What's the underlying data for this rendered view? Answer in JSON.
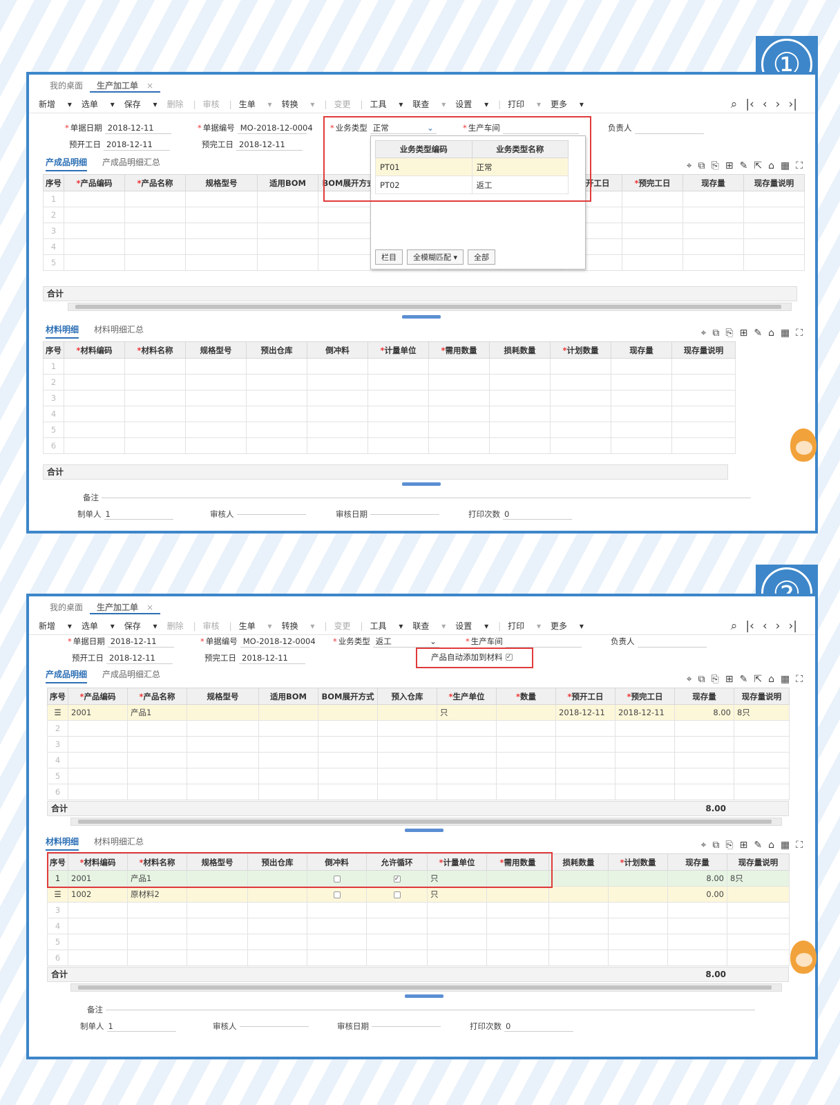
{
  "badges": {
    "one": "①",
    "two": "②"
  },
  "tabs": {
    "desk": "我的桌面",
    "order": "生产加工单",
    "close": "×"
  },
  "toolbar": {
    "new": "新增",
    "select": "选单",
    "save": "保存",
    "delete": "删除",
    "audit": "审核",
    "gen": "生单",
    "convert": "转换",
    "change": "变更",
    "tools": "工具",
    "query": "联查",
    "settings": "设置",
    "print": "打印",
    "more": "更多"
  },
  "form": {
    "date_label": "单据日期",
    "date_value": "2018-12-11",
    "code_label": "单据编号",
    "code_value": "MO-2018-12-0004",
    "btype_label": "业务类型",
    "btype_value1": "正常",
    "btype_value2": "返工",
    "workshop_label": "生产车间",
    "owner_label": "负责人",
    "start_label": "预开工日",
    "start_value": "2018-12-11",
    "finish_label": "预完工日",
    "finish_value": "2018-12-11",
    "auto_add_label": "产品自动添加到材料"
  },
  "subtabs": {
    "prod": "产成品明细",
    "prod_sum": "产成品明细汇总",
    "mat": "材料明细",
    "mat_sum": "材料明细汇总"
  },
  "prod_headers": [
    "序号",
    "产品编码",
    "产品名称",
    "规格型号",
    "适用BOM",
    "BOM展开方式",
    "预入仓库",
    "生产单位",
    "数量",
    "预开工日",
    "预完工日",
    "现存量",
    "现存量说明"
  ],
  "mat_headers1": [
    "序号",
    "材料编码",
    "材料名称",
    "规格型号",
    "预出仓库",
    "倒冲料",
    "计量单位",
    "需用数量",
    "损耗数量",
    "计划数量",
    "现存量",
    "现存量说明"
  ],
  "mat_headers2": [
    "序号",
    "材料编码",
    "材料名称",
    "规格型号",
    "预出仓库",
    "倒冲料",
    "允许循环",
    "计量单位",
    "需用数量",
    "损耗数量",
    "计划数量",
    "现存量",
    "现存量说明"
  ],
  "rownums": [
    "1",
    "2",
    "3",
    "4",
    "5",
    "6"
  ],
  "sum_label": "合计",
  "dropdown": {
    "h_code": "业务类型编码",
    "h_name": "业务类型名称",
    "r1_code": "PT01",
    "r1_name": "正常",
    "r2_code": "PT02",
    "r2_name": "返工",
    "col_btn": "栏目",
    "match": "全模糊匹配",
    "all_btn": "全部"
  },
  "prod_row": {
    "code": "2001",
    "name": "产品1",
    "unit": "只",
    "start": "2018-12-11",
    "finish": "2018-12-11",
    "stock": "8.00",
    "stock_desc": "8只"
  },
  "mat_rows": [
    {
      "no": "1",
      "code": "2001",
      "name": "产品1",
      "unit": "只",
      "stock": "8.00",
      "stock_desc": "8只"
    },
    {
      "code": "1002",
      "name": "原材料2",
      "unit": "只",
      "stock": "0.00"
    }
  ],
  "sum_value": "8.00",
  "footer": {
    "remark": "备注",
    "maker": "制单人",
    "maker_value": "1",
    "auditor": "审核人",
    "audit_date": "审核日期",
    "print_count": "打印次数",
    "print_value": "0"
  },
  "colors": {
    "accent": "#3d86c9",
    "highlight": "#e03a3a",
    "row_yellow": "#fdf7d9",
    "row_green": "#e7f4e3"
  }
}
